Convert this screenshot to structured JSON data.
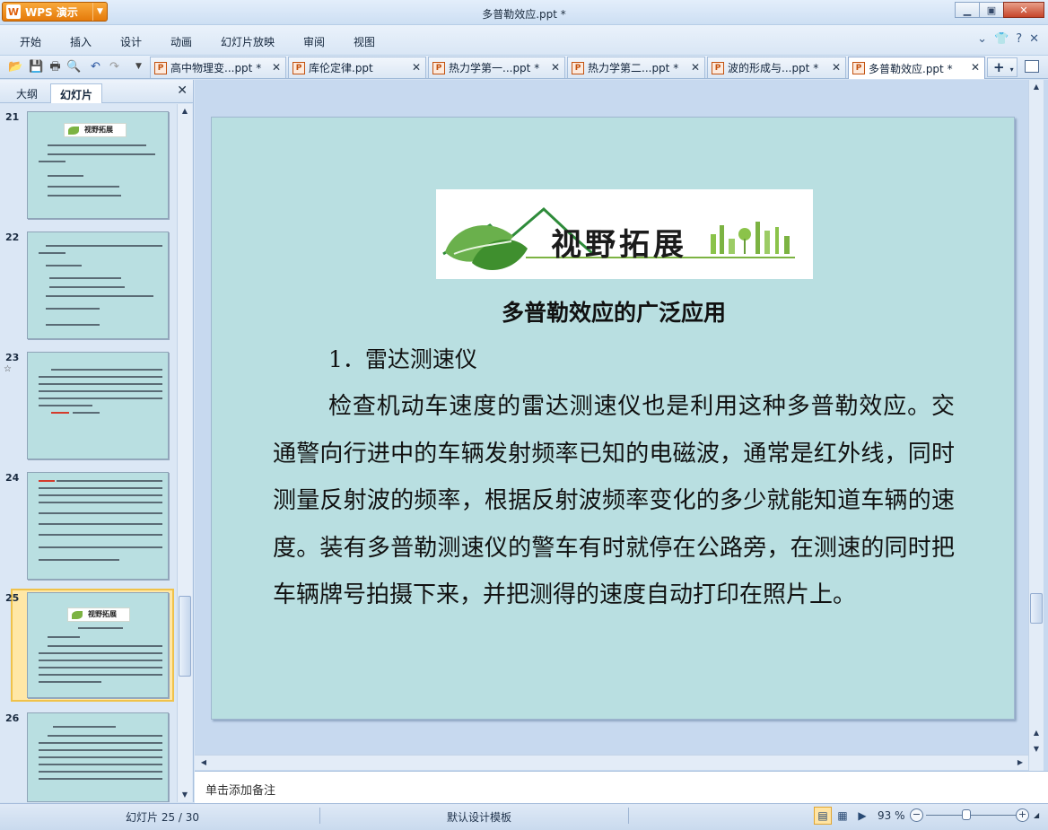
{
  "app": {
    "name": "WPS 演示",
    "window_title": "多普勒效应.ppt *"
  },
  "menu": [
    "开始",
    "插入",
    "设计",
    "动画",
    "幻灯片放映",
    "审阅",
    "视图"
  ],
  "document_tabs": [
    {
      "label": "高中物理变...ppt *",
      "active": false
    },
    {
      "label": "库伦定律.ppt",
      "active": false
    },
    {
      "label": "热力学第一...ppt *",
      "active": false
    },
    {
      "label": "热力学第二...ppt *",
      "active": false
    },
    {
      "label": "波的形成与...ppt *",
      "active": false
    },
    {
      "label": "多普勒效应.ppt *",
      "active": true
    }
  ],
  "left_panel": {
    "tabs": [
      "大纲",
      "幻灯片"
    ],
    "active_tab": "幻灯片",
    "slide_numbers": [
      "21",
      "22",
      "23",
      "24",
      "25",
      "26"
    ],
    "selected_slide": "25",
    "thumb25_logo": "视野拓展"
  },
  "slide": {
    "banner_title": "视野拓展",
    "heading": "多普勒效应的广泛应用",
    "subheading": "1．雷达测速仪",
    "body": "检查机动车速度的雷达测速仪也是利用这种多普勒效应。交通警向行进中的车辆发射频率已知的电磁波，通常是红外线，同时测量反射波的频率，根据反射波频率变化的多少就能知道车辆的速度。装有多普勒测速仪的警车有时就停在公路旁，在测速的同时把车辆牌号拍摄下来，并把测得的速度自动打印在照片上。",
    "background_color": "#b9dfe1"
  },
  "notes_placeholder": "单击添加备注",
  "status": {
    "slide_position": "幻灯片 25 / 30",
    "template": "默认设计模板",
    "zoom": "93 %"
  }
}
